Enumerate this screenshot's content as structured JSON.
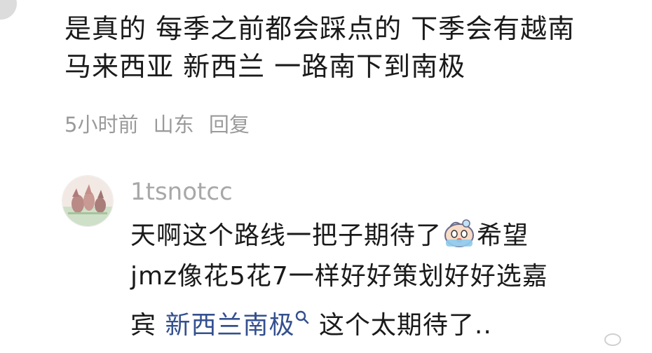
{
  "comment": {
    "lines": [
      "是真的 每季之前都会踩点的 下季会有越南",
      "马来西亚 新西兰 一路南下到南极"
    ],
    "time": "5小时前",
    "location": "山东",
    "reply_label": "回复"
  },
  "reply": {
    "username": "1tsnotcc",
    "line1_text": "天啊这个路线一把子期待了",
    "line1_after": "希望",
    "line2": "jmz像花5花7一样好好策划好好选嘉",
    "line3_before": "宾 ",
    "topic": "新西兰南极",
    "line3_after": "这个太期待了.."
  },
  "colors": {
    "text": "#1a1a1a",
    "meta": "#9a9a9a",
    "username": "#a8a8a8",
    "link": "#34508f"
  }
}
